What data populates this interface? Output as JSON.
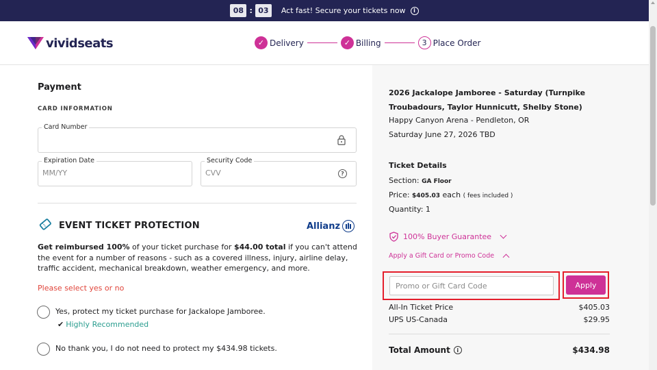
{
  "banner": {
    "timer_minutes": "08",
    "timer_separator": ":",
    "timer_seconds": "03",
    "message": "Act fast! Secure your tickets now",
    "info_icon": "info-icon"
  },
  "header": {
    "logo_text": "vividseats",
    "steps": [
      {
        "label": "Delivery",
        "state": "done"
      },
      {
        "label": "Billing",
        "state": "done"
      },
      {
        "label": "Place Order",
        "number": "3",
        "state": "current"
      }
    ]
  },
  "payment": {
    "title": "Payment",
    "card_info_label": "CARD INFORMATION",
    "card_number_label": "Card Number",
    "card_number_value": "",
    "expiration_label": "Expiration Date",
    "expiration_placeholder": "MM/YY",
    "security_label": "Security Code",
    "security_placeholder": "CVV"
  },
  "protection": {
    "title": "EVENT TICKET PROTECTION",
    "brand": "Allianz",
    "desc_bold1": "Get reimbursed 100%",
    "desc_text1": " of your ticket purchase for ",
    "desc_bold2": "$44.00 total",
    "desc_text2": " if you can't attend the event for a number of reasons - such as a covered illness, injury, airline delay, traffic accident, mechanical breakdown, weather emergency, and more.",
    "error": "Please select yes or no",
    "option_yes": "Yes, protect my ticket purchase for Jackalope Jamboree.",
    "tick": "✔",
    "recommended": "Highly Recommended",
    "option_no": "No thank you, I do not need to protect my $434.98 tickets."
  },
  "summary": {
    "event_title": "2026 Jackalope Jamboree - Saturday (Turnpike Troubadours, Taylor Hunnicutt, Shelby Stone)",
    "venue": "Happy Canyon Arena - Pendleton, OR",
    "date": "Saturday June 27, 2026 TBD",
    "ticket_details_title": "Ticket Details",
    "section_label": "Section: ",
    "section_value": "GA Floor",
    "price_label": "Price: ",
    "price_value": "$405.03",
    "price_each": " each ",
    "price_fees": "( fees included )",
    "quantity": "Quantity: 1",
    "guarantee": "100% Buyer Guarantee",
    "promo_link": "Apply a Gift Card or Promo Code",
    "promo_placeholder": "Promo or Gift Card Code",
    "apply_label": "Apply",
    "rows": [
      {
        "label": "All-In Ticket Price",
        "value": "$405.03"
      },
      {
        "label": "UPS US-Canada",
        "value": "$29.95"
      }
    ],
    "total_label": "Total Amount",
    "total_value": "$434.98"
  },
  "colors": {
    "brand_pink": "#ce3197",
    "navy": "#232453",
    "error_red": "#e0443a",
    "recommended_teal": "#2a9d8f"
  }
}
